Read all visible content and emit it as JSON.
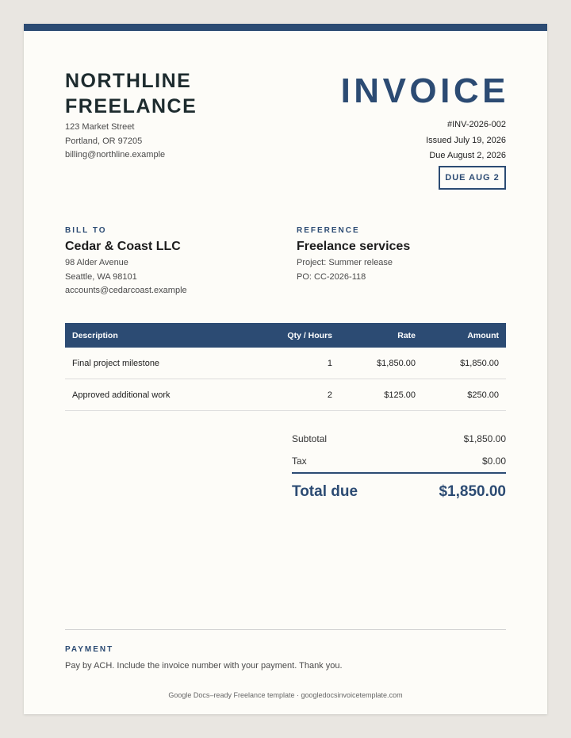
{
  "brand": {
    "name_line1": "NORTHLINE",
    "name_line2": "FREELANCE",
    "address1": "123 Market Street",
    "address2": "Portland, OR 97205",
    "email": "billing@northline.example"
  },
  "invoice": {
    "title": "INVOICE",
    "number": "#INV-2026-002",
    "issued": "Issued July 19, 2026",
    "due": "Due August 2, 2026",
    "badge": "DUE AUG 2"
  },
  "bill_to": {
    "label": "BILL TO",
    "name": "Cedar & Coast LLC",
    "address1": "98 Alder Avenue",
    "address2": "Seattle, WA 98101",
    "email": "accounts@cedarcoast.example"
  },
  "reference": {
    "label": "REFERENCE",
    "title": "Freelance services",
    "project": "Project: Summer release",
    "po": "PO: CC-2026-118"
  },
  "items": {
    "headers": {
      "description": "Description",
      "qty": "Qty / Hours",
      "rate": "Rate",
      "amount": "Amount"
    },
    "rows": [
      {
        "description": "Final project milestone",
        "qty": "1",
        "rate": "$1,850.00",
        "amount": "$1,850.00"
      },
      {
        "description": "Approved additional work",
        "qty": "2",
        "rate": "$125.00",
        "amount": "$250.00"
      }
    ]
  },
  "totals": {
    "subtotal_label": "Subtotal",
    "subtotal": "$1,850.00",
    "tax_label": "Tax",
    "tax": "$0.00",
    "total_label": "Total due",
    "total": "$1,850.00"
  },
  "payment": {
    "label": "PAYMENT",
    "text": "Pay by ACH. Include the invoice number with your payment. Thank you."
  },
  "credit": "Google Docs–ready Freelance template · googledocsinvoicetemplate.com",
  "colors": {
    "accent": "#2c4b73",
    "paper": "#fdfcf8",
    "background": "#e9e6e1"
  }
}
